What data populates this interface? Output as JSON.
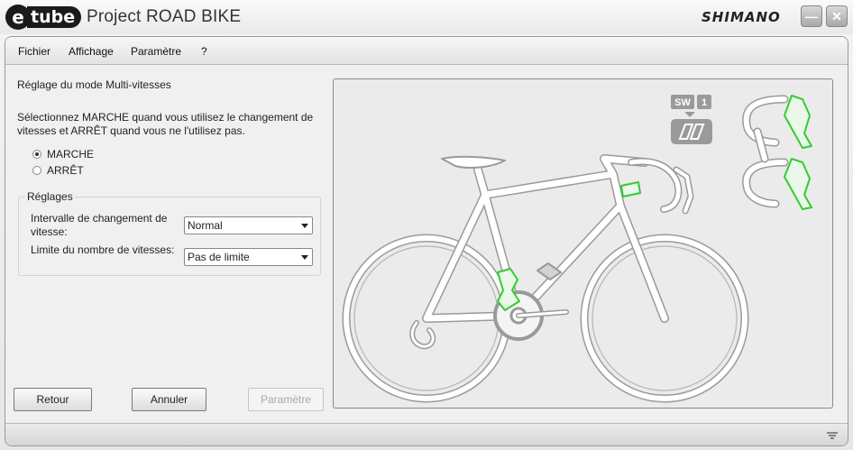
{
  "titlebar": {
    "logo_e": "e",
    "logo_tube": "tube",
    "app_title": "Project  ROAD BIKE",
    "brand": "SHIMANO",
    "minimize_icon": "minimize-icon",
    "close_icon": "close-icon",
    "minimize_glyph": "—",
    "close_glyph": "✕"
  },
  "menu": {
    "items": [
      {
        "label": "Fichier"
      },
      {
        "label": "Affichage"
      },
      {
        "label": "Paramètre"
      },
      {
        "label": "?"
      }
    ]
  },
  "panel": {
    "heading": "Réglage du mode Multi-vitesses",
    "instruction": "Sélectionnez MARCHE quand vous utilisez le changement de vitesses et ARRÊT quand vous ne l'utilisez pas.",
    "options": [
      {
        "label": "MARCHE",
        "selected": true
      },
      {
        "label": "ARRÊT",
        "selected": false
      }
    ],
    "settings_group": {
      "title": "Réglages",
      "interval_label": "Intervalle de changement de vitesse:",
      "interval_value": "Normal",
      "limit_label": "Limite du nombre de vitesses:",
      "limit_value": "Pas de limite"
    }
  },
  "buttons": {
    "back": "Retour",
    "cancel": "Annuler",
    "param": "Paramètre"
  },
  "diagram": {
    "switch_label": "SW",
    "switch_number": "1",
    "highlight_color": "#33cc33",
    "bike_line_color": "#ffffff",
    "bike_shadow_color": "#9a9a9a"
  }
}
